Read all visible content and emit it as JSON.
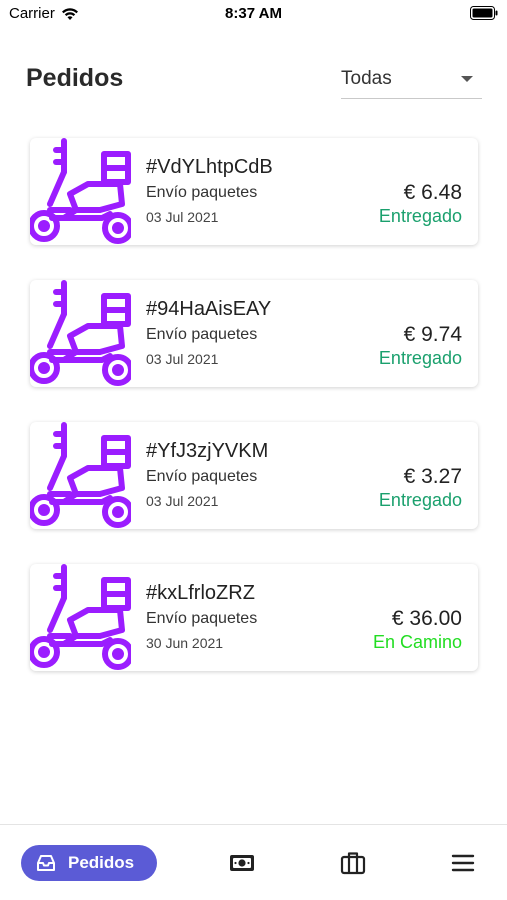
{
  "status_bar": {
    "carrier": "Carrier",
    "time": "8:37 AM"
  },
  "header": {
    "title": "Pedidos",
    "filter_value": "Todas"
  },
  "orders": [
    {
      "id": "#VdYLhtpCdB",
      "service": "Envío paquetes",
      "date": "03 Jul 2021",
      "price": "€ 6.48",
      "status": "Entregado",
      "status_color": "#1aa06d"
    },
    {
      "id": "#94HaAisEAY",
      "service": "Envío paquetes",
      "date": "03 Jul 2021",
      "price": "€ 9.74",
      "status": "Entregado",
      "status_color": "#1aa06d"
    },
    {
      "id": "#YfJ3zjYVKM",
      "service": "Envío paquetes",
      "date": "03 Jul 2021",
      "price": "€ 3.27",
      "status": "Entregado",
      "status_color": "#1aa06d"
    },
    {
      "id": "#kxLfrloZRZ",
      "service": "Envío paquetes",
      "date": "30 Jun 2021",
      "price": "€ 36.00",
      "status": "En Camino",
      "status_color": "#22dd22"
    }
  ],
  "bottom_nav": {
    "active_label": "Pedidos",
    "active_icon": "inbox-icon",
    "items": [
      "cash-icon",
      "briefcase-icon",
      "menu-icon"
    ]
  },
  "colors": {
    "accent": "#5b5bd6",
    "icon_purple": "#9b1dff",
    "delivered": "#1aa06d",
    "in_transit": "#22dd22"
  }
}
